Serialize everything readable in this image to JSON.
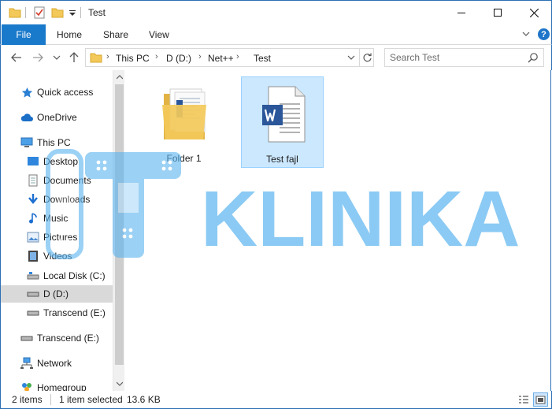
{
  "window": {
    "title": "Test",
    "controls": {
      "minimize": "minimize",
      "maximize": "maximize",
      "close": "close"
    }
  },
  "quick_access_toolbar": {
    "icons": [
      "folder-icon",
      "properties-check-icon",
      "new-folder-icon",
      "customize-dropdown-icon"
    ]
  },
  "ribbon": {
    "tabs": [
      {
        "label": "File",
        "active": true
      },
      {
        "label": "Home"
      },
      {
        "label": "Share"
      },
      {
        "label": "View"
      }
    ],
    "help_label": "?"
  },
  "address_bar": {
    "breadcrumb": [
      "This PC",
      "D (D:)",
      "Net++",
      "Test"
    ],
    "separator": "›"
  },
  "search": {
    "placeholder": "Search Test"
  },
  "sidebar": {
    "items": [
      {
        "label": "Quick access",
        "icon": "star-icon",
        "level": 0
      },
      {
        "label": "OneDrive",
        "icon": "cloud-icon",
        "level": 0
      },
      {
        "label": "This PC",
        "icon": "computer-icon",
        "level": 0
      },
      {
        "label": "Desktop",
        "icon": "desktop-icon",
        "level": 1
      },
      {
        "label": "Documents",
        "icon": "documents-icon",
        "level": 1
      },
      {
        "label": "Downloads",
        "icon": "download-icon",
        "level": 1
      },
      {
        "label": "Music",
        "icon": "music-icon",
        "level": 1
      },
      {
        "label": "Pictures",
        "icon": "pictures-icon",
        "level": 1
      },
      {
        "label": "Videos",
        "icon": "videos-icon",
        "level": 1
      },
      {
        "label": "Local Disk (C:)",
        "icon": "drive-icon",
        "level": 1
      },
      {
        "label": "D (D:)",
        "icon": "drive-icon",
        "level": 1,
        "selected": true
      },
      {
        "label": "Transcend (E:)",
        "icon": "usb-drive-icon",
        "level": 1
      },
      {
        "label": "Transcend (E:)",
        "icon": "usb-drive-icon",
        "level": 0
      },
      {
        "label": "Network",
        "icon": "network-icon",
        "level": 0
      },
      {
        "label": "Homegroup",
        "icon": "homegroup-icon",
        "level": 0
      }
    ]
  },
  "files": [
    {
      "name": "Folder 1",
      "type": "folder",
      "icon": "folder-icon",
      "selected": false
    },
    {
      "name": "Test fajl",
      "type": "word-document",
      "icon": "word-document-icon",
      "selected": true
    }
  ],
  "watermark": {
    "text": "KLINIKA",
    "color": "#5fb6f0"
  },
  "status_bar": {
    "item_count": "2 items",
    "selection": "1 item selected",
    "size": "13.6 KB"
  },
  "colors": {
    "accent": "#1979ca",
    "selection_bg": "#cce8ff",
    "selection_border": "#99d1ff",
    "window_border": "#2b6fb6",
    "word_blue": "#2b579a",
    "folder_yellow": "#f3c95a"
  }
}
